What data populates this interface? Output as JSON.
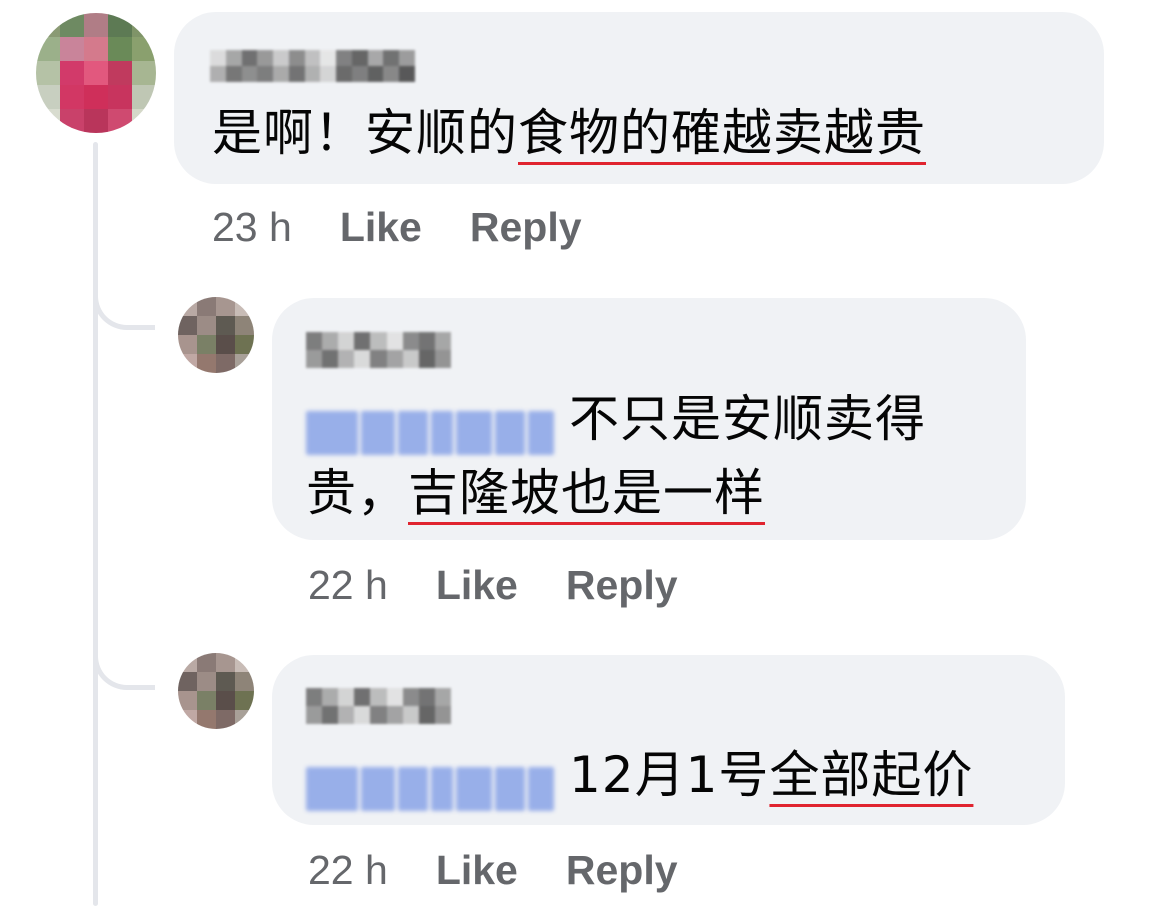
{
  "comments": [
    {
      "author_blurred": true,
      "mention_blurred": false,
      "text_plain": "是啊！安顺的",
      "text_underlined": "食物的確越卖越贵",
      "time": "23 h",
      "like_label": "Like",
      "reply_label": "Reply"
    },
    {
      "author_blurred": true,
      "mention_blurred": true,
      "text_line1": "不只是安顺卖得",
      "text_line2_plain": "贵，",
      "text_line2_underlined": "吉隆坡也是一样",
      "time": "22 h",
      "like_label": "Like",
      "reply_label": "Reply"
    },
    {
      "author_blurred": true,
      "mention_blurred": true,
      "text_plain": "12月1号",
      "text_underlined": "全部起价",
      "time": "22 h",
      "like_label": "Like",
      "reply_label": "Reply"
    }
  ],
  "colors": {
    "bubble": "#f0f2f5",
    "meta_text": "#65676b",
    "underline": "#e0242f",
    "mention": "#8fa8e8",
    "thread_line": "#e4e6eb"
  }
}
